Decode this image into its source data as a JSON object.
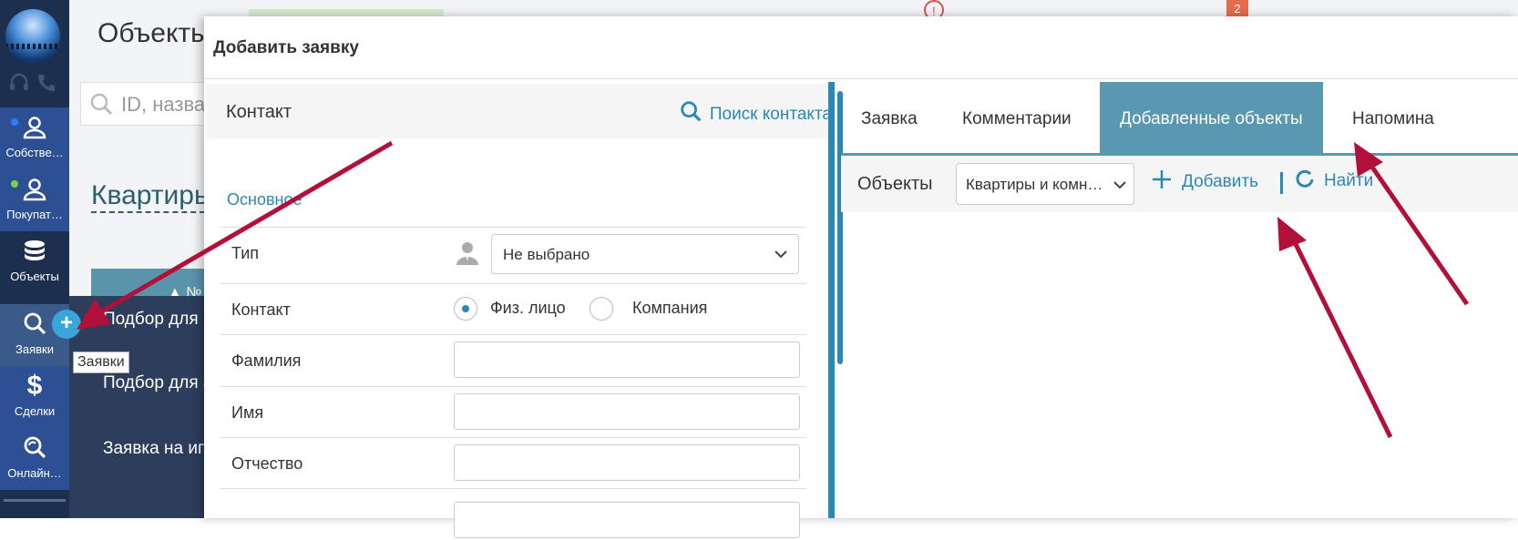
{
  "sidebar": {
    "items": [
      {
        "label": "Собстве…",
        "icon": "user-icon",
        "dot": "#2b7bff"
      },
      {
        "label": "Покупат…",
        "icon": "user-icon",
        "dot": "#7cd14a"
      },
      {
        "label": "Объекты",
        "icon": "database-icon"
      },
      {
        "label": "Заявки",
        "icon": "search-icon"
      },
      {
        "label": "Сделки",
        "icon": "dollar-icon"
      },
      {
        "label": "Онлайн…",
        "icon": "search-refresh-icon"
      }
    ]
  },
  "background": {
    "title": "Объекты",
    "search_placeholder": "ID, назва",
    "section": "Квартиры",
    "table_header": "▲ №",
    "rows": [
      "Подбор для",
      "Подбор для а",
      "Заявка на ип"
    ],
    "alert_glyph": "!",
    "badge_count": "2"
  },
  "tooltip": "Заявки",
  "modal": {
    "title": "Добавить заявку",
    "contact_header": "Контакт",
    "contact_search": "Поиск контакта",
    "section_title": "Основное",
    "fields": {
      "type_label": "Тип",
      "type_value": "Не выбрано",
      "contact_label": "Контакт",
      "radio_person": "Физ. лицо",
      "radio_company": "Компания",
      "lastname_label": "Фамилия",
      "firstname_label": "Имя",
      "patronymic_label": "Отчество"
    },
    "tabs": [
      "Заявка",
      "Комментарии",
      "Добавленные объекты",
      "Напомина"
    ],
    "active_tab": 2,
    "toolbar": {
      "label": "Объекты",
      "select_value": "Квартиры и комн…",
      "add_label": "Добавить",
      "find_label": "Найти"
    }
  },
  "colors": {
    "accent": "#2a88b4",
    "tab_active_bg": "#5a98b0",
    "sidebar_bg": "#1d2f4f",
    "arrow": "#b0103a"
  }
}
